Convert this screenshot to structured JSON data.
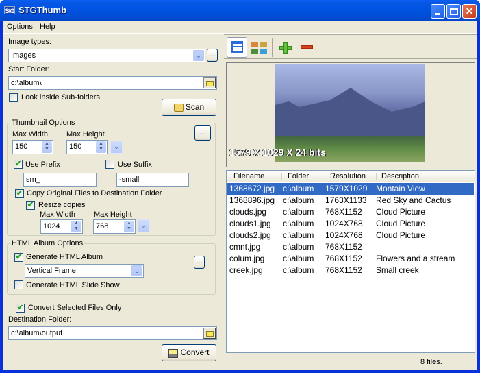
{
  "window": {
    "title": "STGThumb",
    "app_icon_text": "StG",
    "controls": {
      "minimize": "_",
      "maximize": "□",
      "close": "✕"
    }
  },
  "menu": [
    {
      "label": "Options",
      "accel": "O"
    },
    {
      "label": "Help",
      "accel": "H"
    }
  ],
  "left": {
    "image_types_label": "Image types:",
    "image_types_value": "Images",
    "image_types_more": "...",
    "start_folder_label": "Start Folder:",
    "start_folder_value": "c:\\album\\",
    "subfolders_label": "Look inside Sub-folders",
    "subfolders_checked": false,
    "scan_label": "Scan",
    "thumbnail": {
      "title": "Thumbnail Options",
      "max_width_label": "Max Width",
      "max_width": "150",
      "max_height_label": "Max Height",
      "max_height": "150",
      "more": "...",
      "use_prefix_label": "Use Prefix",
      "use_prefix_checked": true,
      "prefix": "sm_",
      "use_suffix_label": "Use Suffix",
      "use_suffix_checked": false,
      "suffix": "-small",
      "copy_label": "Copy Original Files to Destination Folder",
      "copy_checked": true,
      "resize_label": "Resize copies",
      "resize_checked": true,
      "copy_max_width_label": "Max Width",
      "copy_max_width": "1024",
      "copy_max_height_label": "Max Height",
      "copy_max_height": "768"
    },
    "html": {
      "title": "HTML Album Options",
      "gen_album_label": "Generate HTML Album",
      "gen_album_checked": true,
      "layout_value": "Vertical Frame",
      "more": "...",
      "slideshow_label": "Generate HTML Slide Show",
      "slideshow_checked": false
    },
    "convert_selected_label": "Convert Selected Files Only",
    "convert_selected_checked": true,
    "dest_folder_label": "Destination Folder:",
    "dest_folder_value": "c:\\album\\output",
    "convert_label": "Convert"
  },
  "right": {
    "toolbar": [
      "details-view",
      "thumbnail-view",
      "add",
      "remove"
    ],
    "preview_caption": "1579 X 1029 X 24 bits",
    "columns": [
      "Filename",
      "Folder",
      "Resolution",
      "Description"
    ],
    "rows": [
      {
        "filename": "1368672.jpg",
        "folder": "c:\\album",
        "resolution": "1579X1029",
        "description": "Montain View",
        "selected": true
      },
      {
        "filename": "1368896.jpg",
        "folder": "c:\\album",
        "resolution": "1763X1133",
        "description": "Red Sky and Cactus"
      },
      {
        "filename": "clouds.jpg",
        "folder": "c:\\album",
        "resolution": "768X1152",
        "description": "Cloud Picture"
      },
      {
        "filename": "clouds1.jpg",
        "folder": "c:\\album",
        "resolution": "1024X768",
        "description": "Cloud Picture"
      },
      {
        "filename": "clouds2.jpg",
        "folder": "c:\\album",
        "resolution": "1024X768",
        "description": "Cloud Picture"
      },
      {
        "filename": "cmnt.jpg",
        "folder": "c:\\album",
        "resolution": "768X1152",
        "description": ""
      },
      {
        "filename": "colum.jpg",
        "folder": "c:\\album",
        "resolution": "768X1152",
        "description": "Flowers and a stream"
      },
      {
        "filename": "creek.jpg",
        "folder": "c:\\album",
        "resolution": "768X1152",
        "description": "Small creek"
      }
    ],
    "status": "8 files."
  }
}
